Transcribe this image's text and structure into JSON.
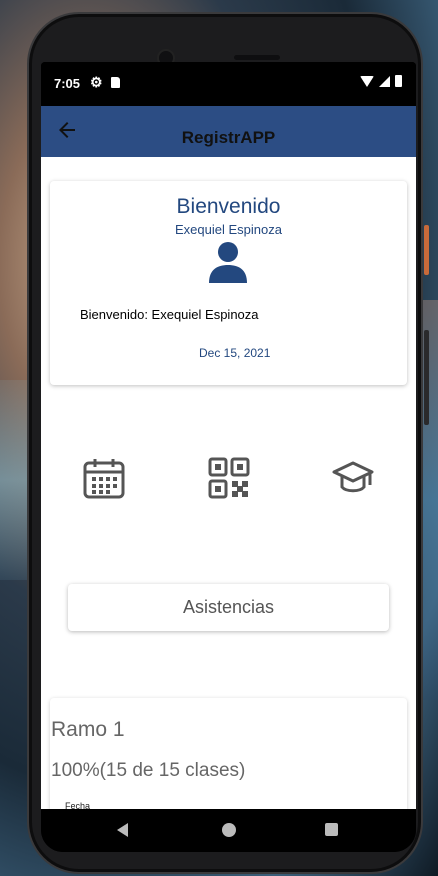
{
  "status_bar": {
    "time": "7:05"
  },
  "toolbar": {
    "title": "RegistrAPP",
    "back_icon": "arrow-left-icon"
  },
  "profile_card": {
    "title": "Bienvenido",
    "name": "Exequiel Espinoza",
    "welcome_text": "Bienvenido: Exequiel Espinoza",
    "date": "Dec 15, 2021",
    "avatar_icon": "person-icon",
    "accent_color": "#23487f"
  },
  "actions": [
    {
      "icon": "calendar-icon"
    },
    {
      "icon": "qr-code-icon"
    },
    {
      "icon": "graduation-cap-icon"
    }
  ],
  "asistencias_button": {
    "label": "Asistencias"
  },
  "ramo_card": {
    "title": "Ramo 1",
    "attendance": "100%(15 de 15 clases)",
    "fecha_label": "Fecha"
  },
  "theme": {
    "toolbar_color": "#2c4d84"
  }
}
